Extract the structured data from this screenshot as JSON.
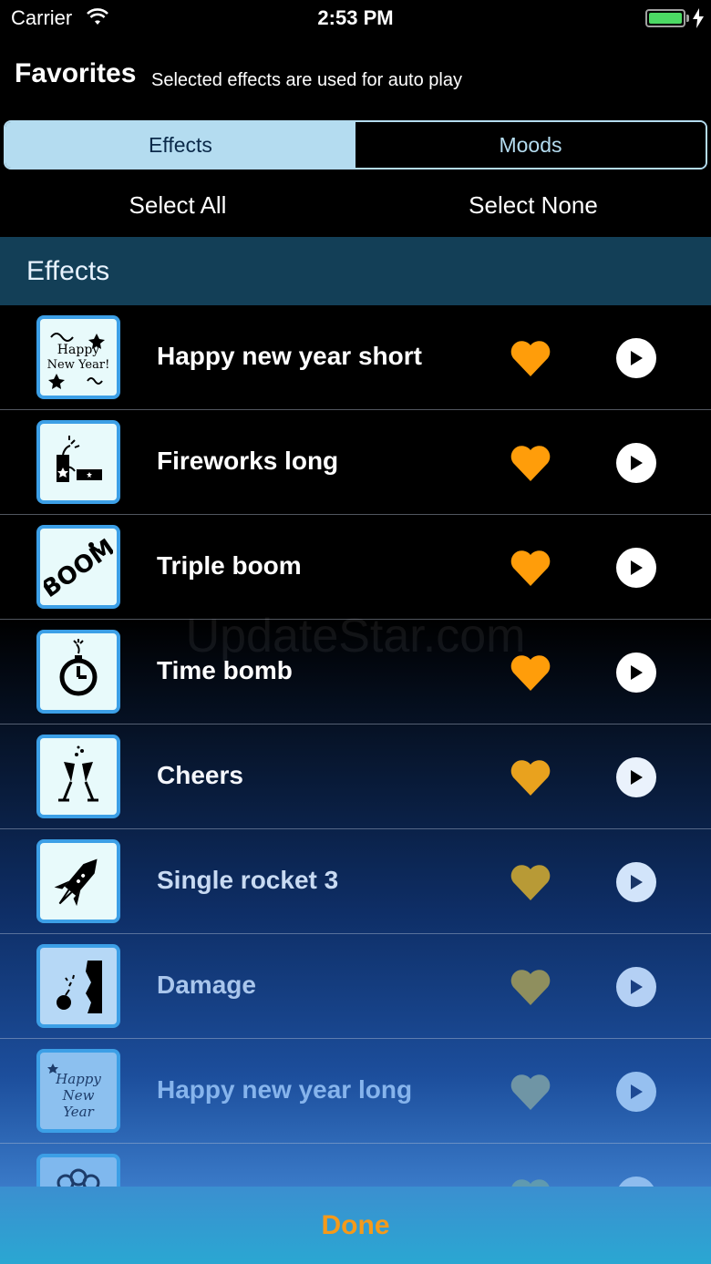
{
  "status_bar": {
    "carrier": "Carrier",
    "time": "2:53 PM",
    "battery_color": "#4cd964"
  },
  "header": {
    "title": "Favorites",
    "subtitle": "Selected effects are used for auto play"
  },
  "segments": [
    {
      "label": "Effects",
      "selected": true
    },
    {
      "label": "Moods",
      "selected": false
    }
  ],
  "actions": {
    "select_all": "Select All",
    "select_none": "Select None"
  },
  "section": {
    "title": "Effects"
  },
  "rows": [
    {
      "label": "Happy new year short",
      "thumb_icon": "happy-new-year-icon",
      "favorite": true
    },
    {
      "label": "Fireworks long",
      "thumb_icon": "firecracker-icon",
      "favorite": true
    },
    {
      "label": "Triple boom",
      "thumb_icon": "boom-icon",
      "favorite": true
    },
    {
      "label": "Time bomb",
      "thumb_icon": "stopwatch-bomb-icon",
      "favorite": true
    },
    {
      "label": "Cheers",
      "thumb_icon": "champagne-glasses-icon",
      "favorite": true
    },
    {
      "label": "Single rocket 3",
      "thumb_icon": "rocket-icon",
      "favorite": true
    },
    {
      "label": "Damage",
      "thumb_icon": "bomb-wall-icon",
      "favorite": true
    },
    {
      "label": "Happy new year long",
      "thumb_icon": "happy-new-year-script-icon",
      "favorite": true
    },
    {
      "label": "",
      "thumb_icon": "firework-burst-icon",
      "favorite": true
    }
  ],
  "watermark": "UpdateStar.com",
  "bottom": {
    "done_label": "Done"
  },
  "colors": {
    "accent_orange": "#f59a1a",
    "segment_blue": "#b4dcf0",
    "section_header": "#133f57"
  }
}
